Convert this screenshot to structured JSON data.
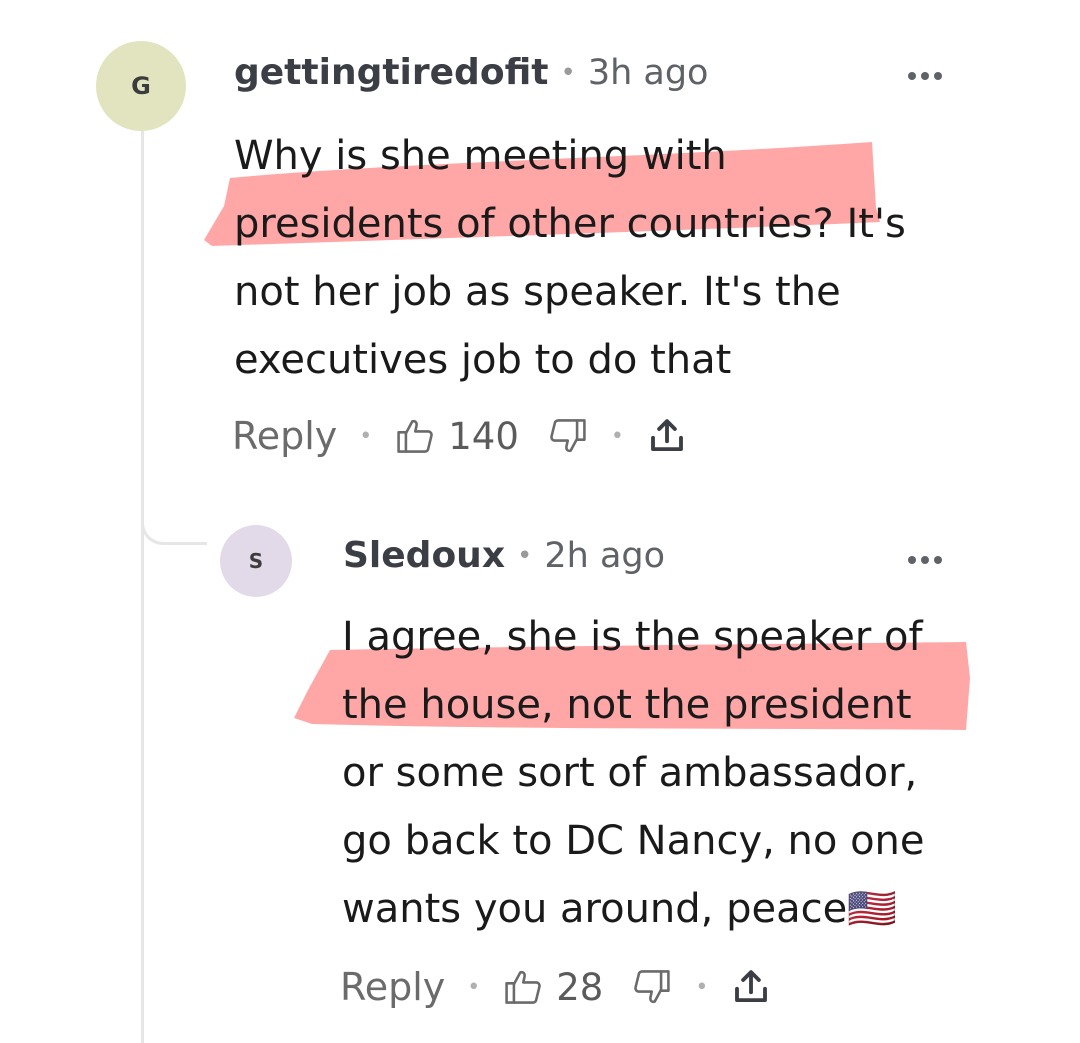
{
  "comments": [
    {
      "avatar_letter": "G",
      "username": "gettingtiredofit",
      "time": "3h ago",
      "lines": [
        "Why is she meeting with",
        "presidents of other countries? It's",
        "not her job as speaker. It's the",
        "executives job to do that"
      ],
      "reply_label": "Reply",
      "likes": "140"
    },
    {
      "avatar_letter": "S",
      "username": "Sledoux",
      "time": "2h ago",
      "lines": [
        "I agree, she is the speaker of",
        "the house, not the president",
        "or some sort of ambassador,",
        "go back to DC Nancy, no one",
        "wants you around, peace"
      ],
      "emoji": "🇺🇸",
      "reply_label": "Reply",
      "likes": "28"
    }
  ],
  "icons": {
    "more": "more-options-icon",
    "upvote": "thumbs-up-icon",
    "downvote": "thumbs-down-icon",
    "share": "share-icon"
  },
  "colors": {
    "highlight": "#ff8e8e",
    "avatar_g": "#e1e4bf",
    "avatar_s": "#e3dae9",
    "thread_line": "#e6e6e6"
  }
}
